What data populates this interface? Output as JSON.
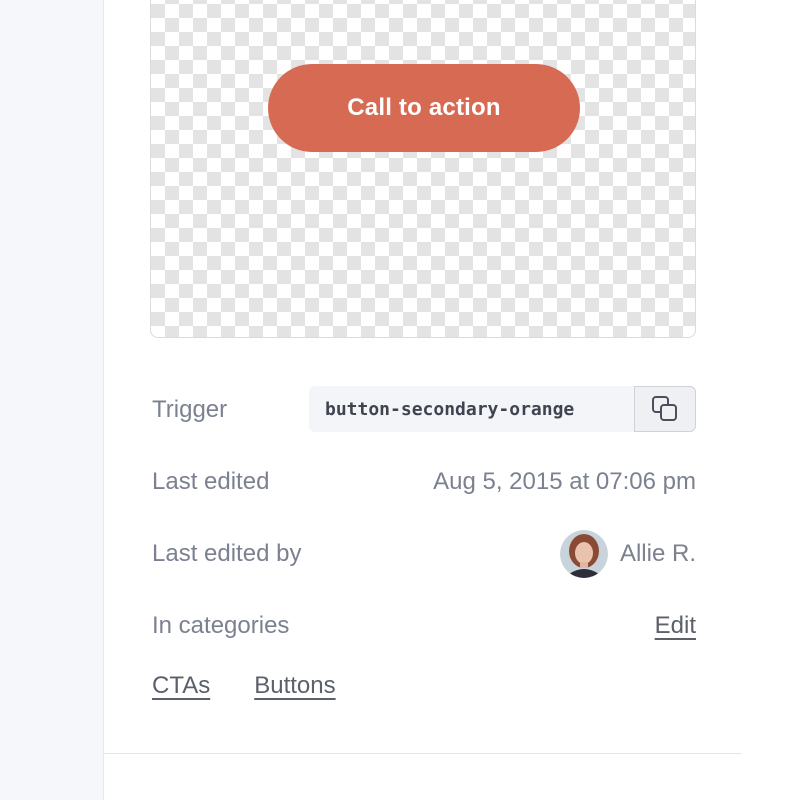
{
  "preview": {
    "cta_label": "Call to action"
  },
  "details": {
    "trigger": {
      "label": "Trigger",
      "value": "button-secondary-orange",
      "copy_icon": "copy-icon"
    },
    "last_edited": {
      "label": "Last edited",
      "value": "Aug 5, 2015 at 07:06 pm"
    },
    "last_edited_by": {
      "label": "Last edited by",
      "name": "Allie R.",
      "avatar_icon": "avatar"
    },
    "categories": {
      "label": "In categories",
      "edit_label": "Edit",
      "items": [
        "CTAs",
        "Buttons"
      ]
    }
  },
  "colors": {
    "cta": "#d66a52",
    "text_muted": "#7b8190",
    "code_bg": "#f3f5f8"
  }
}
